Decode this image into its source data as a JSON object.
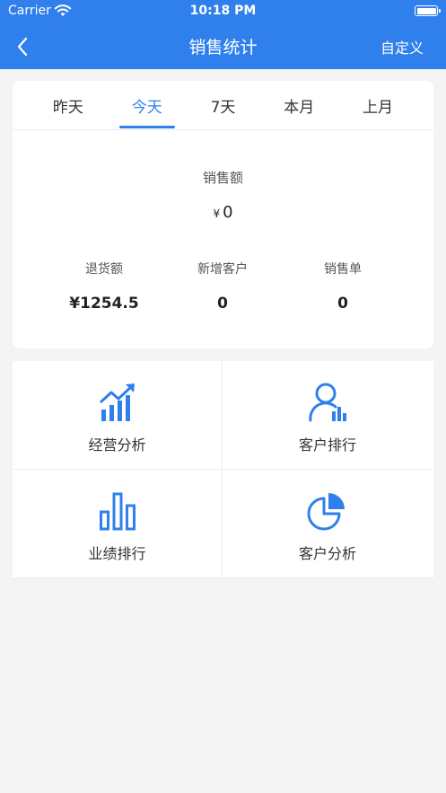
{
  "status_bar": {
    "carrier": "Carrier",
    "time": "10:18 PM"
  },
  "nav": {
    "title": "销售统计",
    "right": "自定义"
  },
  "tabs": [
    {
      "label": "昨天",
      "active": false
    },
    {
      "label": "今天",
      "active": true
    },
    {
      "label": "7天",
      "active": false
    },
    {
      "label": "本月",
      "active": false
    },
    {
      "label": "上月",
      "active": false
    }
  ],
  "summary": {
    "sales_label": "销售额",
    "sales_currency": "¥",
    "sales_value": "0",
    "stats": [
      {
        "label": "退货额",
        "value": "¥1254.5"
      },
      {
        "label": "新增客户",
        "value": "0"
      },
      {
        "label": "销售单",
        "value": "0"
      }
    ]
  },
  "menu": [
    {
      "label": "经营分析",
      "icon": "trend-chart-icon"
    },
    {
      "label": "客户排行",
      "icon": "user-ranking-icon"
    },
    {
      "label": "业绩排行",
      "icon": "bar-chart-icon"
    },
    {
      "label": "客户分析",
      "icon": "pie-chart-icon"
    }
  ],
  "colors": {
    "accent": "#2f80ec",
    "background": "#f4f4f4"
  }
}
